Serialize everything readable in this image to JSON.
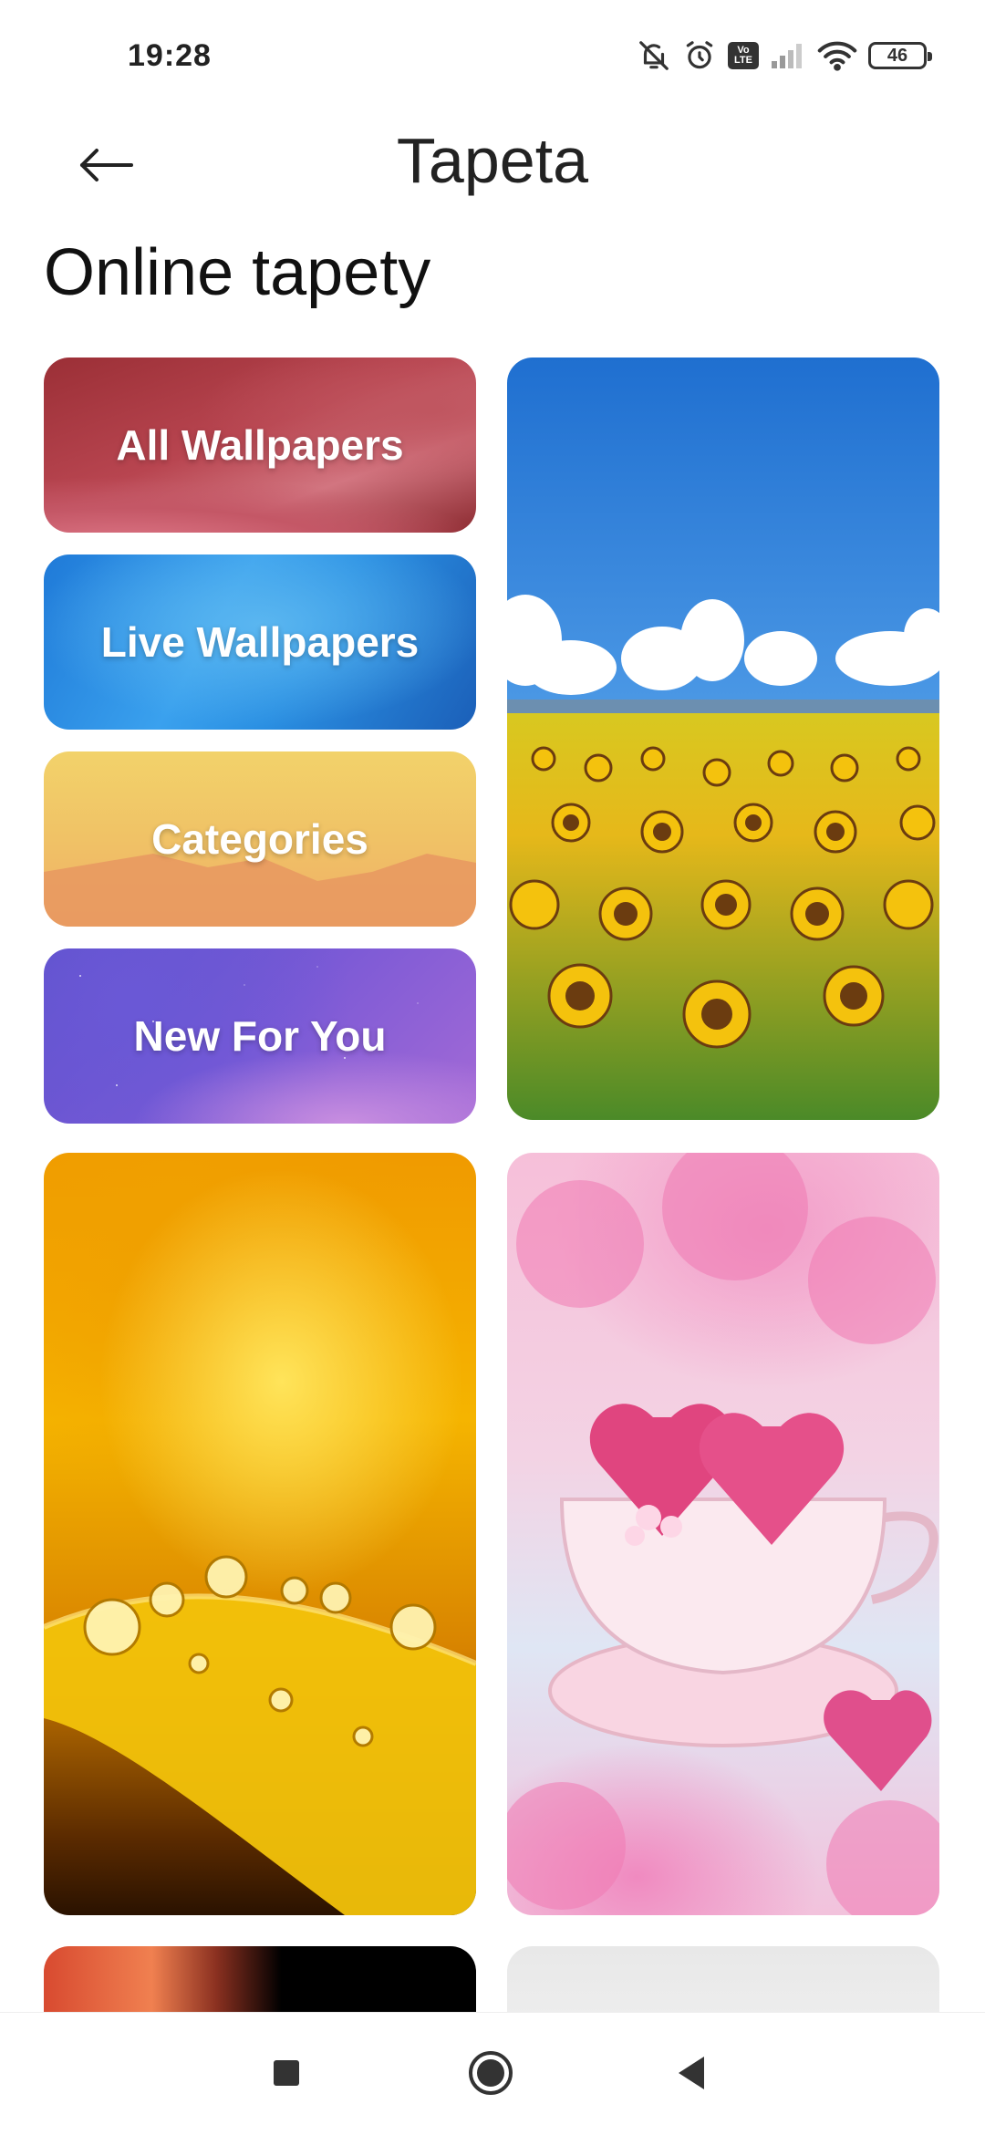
{
  "status_bar": {
    "time": "19:28",
    "icons": [
      "mute-bell-icon",
      "alarm-icon",
      "volte-icon",
      "signal-icon",
      "wifi-icon",
      "battery-icon"
    ],
    "volte_line1": "Vo",
    "volte_line2": "LTE",
    "battery_level": "46"
  },
  "header": {
    "back_icon": "arrow-left-icon",
    "title": "Tapeta"
  },
  "section": {
    "title": "Online tapety"
  },
  "categories": [
    {
      "label": "All Wallpapers"
    },
    {
      "label": "Live Wallpapers"
    },
    {
      "label": "Categories"
    },
    {
      "label": "New For You"
    }
  ],
  "wallpapers": [
    {
      "name": "sunflower-field"
    },
    {
      "name": "water-drops-on-petal"
    },
    {
      "name": "pink-macarons-teacup"
    },
    {
      "name": "planet"
    },
    {
      "name": "light-abstract"
    }
  ],
  "nav_bar": {
    "icons": [
      "recents-square-icon",
      "home-circle-icon",
      "back-triangle-icon"
    ]
  },
  "colors": {
    "background": "#ffffff",
    "text": "#111111"
  }
}
